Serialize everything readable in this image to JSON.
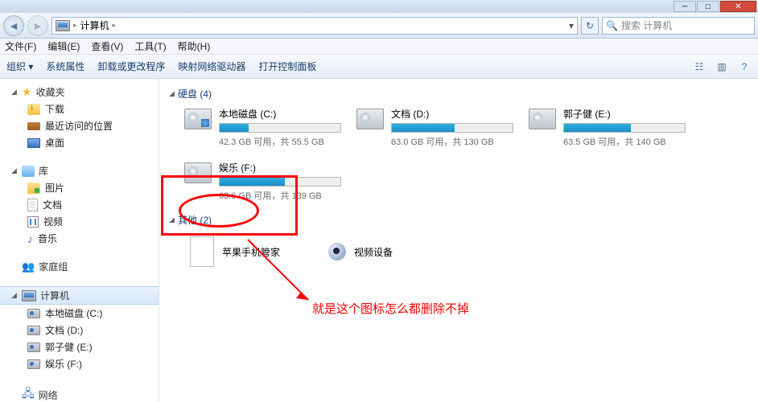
{
  "address": {
    "location": "计算机",
    "sep": "▸"
  },
  "search": {
    "placeholder": "搜索 计算机"
  },
  "menu": {
    "file": "文件(F)",
    "edit": "编辑(E)",
    "view": "查看(V)",
    "tools": "工具(T)",
    "help": "帮助(H)"
  },
  "toolbar": {
    "organize": "组织 ▾",
    "props": "系统属性",
    "uninstall": "卸载或更改程序",
    "mapnet": "映射网络驱动器",
    "cpanel": "打开控制面板"
  },
  "sidebar": {
    "fav": {
      "head": "收藏夹",
      "downloads": "下载",
      "recent": "最近访问的位置",
      "desktop": "桌面"
    },
    "lib": {
      "head": "库",
      "pictures": "图片",
      "documents": "文档",
      "videos": "视频",
      "music": "音乐"
    },
    "homegroup": "家庭组",
    "computer": {
      "head": "计算机",
      "c": "本地磁盘 (C:)",
      "d": "文档 (D:)",
      "e": "郭子健 (E:)",
      "f": "娱乐 (F:)"
    },
    "network": "网络"
  },
  "sections": {
    "drives": "硬盘 (4)",
    "other": "其他 (2)"
  },
  "drives": {
    "c": {
      "name": "本地磁盘 (C:)",
      "text": "42.3 GB 可用，共 55.5 GB",
      "pct": 24
    },
    "d": {
      "name": "文档 (D:)",
      "text": "63.0 GB 可用，共 130 GB",
      "pct": 52
    },
    "e": {
      "name": "郭子健 (E:)",
      "text": "63.5 GB 可用，共 140 GB",
      "pct": 55
    },
    "f": {
      "name": "娱乐 (F:)",
      "text": "63.6 GB 可用，共 139 GB",
      "pct": 54
    }
  },
  "other": {
    "apple": "苹果手机管家",
    "video": "视频设备"
  },
  "annotation": "就是这个图标怎么都删除不掉"
}
